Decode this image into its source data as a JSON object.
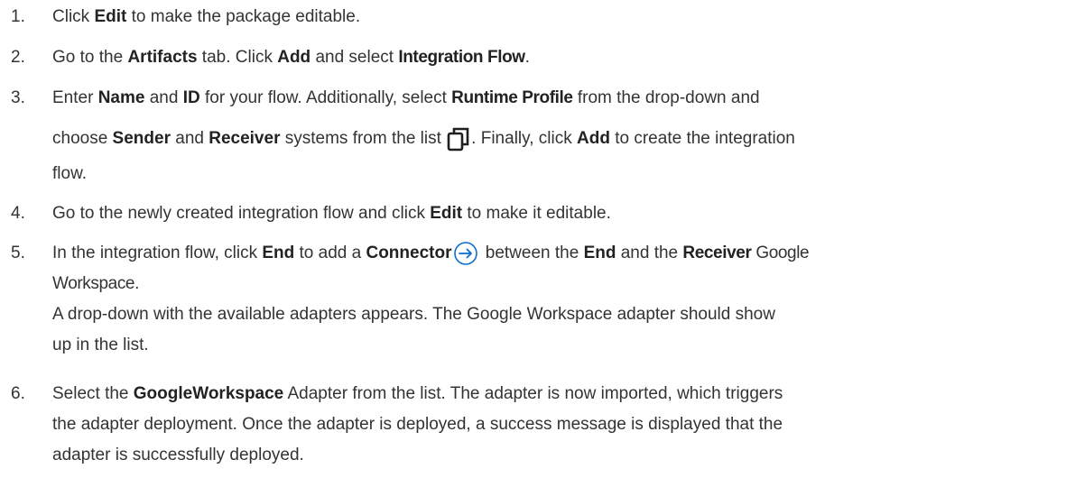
{
  "steps": [
    {
      "number": "1.",
      "p1": "Click ",
      "b1": "Edit",
      "p2": " to make the package editable."
    },
    {
      "number": "2.",
      "p1": "Go to the ",
      "b1": "Artifacts",
      "p2": " tab. Click ",
      "b2": "Add",
      "p3": " and select ",
      "b3": "Integration Flow",
      "p4": "."
    },
    {
      "number": "3.",
      "p1": "Enter ",
      "b1": "Name",
      "p2": " and ",
      "b2": "ID",
      "p3": " for your flow. Additionally, select ",
      "b3": "Runtime Profile",
      "p4": " from the drop-down and",
      "p5": "choose ",
      "b4": "Sender",
      "p6": " and ",
      "b5": "Receiver",
      "p7": " systems from the list ",
      "p8": ". Finally, click ",
      "b6": "Add",
      "p9": " to create the integration",
      "p10": "flow."
    },
    {
      "number": "4.",
      "p1": "Go to the newly created integration flow and click ",
      "b1": "Edit",
      "p2": " to make it editable."
    },
    {
      "number": "5.",
      "p1": "In the integration flow, click ",
      "b1": "End",
      "p2": " to add a ",
      "b2": "Connector",
      "p3": " between the ",
      "b3": "End",
      "p4": " and the ",
      "b4": "Receiver",
      "p5": " Google",
      "p6": "Workspace.",
      "p7": "A drop-down with the available adapters appears. The Google Workspace adapter should show",
      "p8": "up in the list."
    },
    {
      "number": "6.",
      "p1": "Select the ",
      "b1": "GoogleWorkspace",
      "p2": " Adapter from the list. The adapter is now imported, which triggers",
      "p3": "the adapter deployment. Once the adapter is deployed, a success message is displayed that the",
      "p4": "adapter is successfully deployed."
    }
  ],
  "icons": {
    "copy": "copy-icon",
    "connector": "arrow-right-circle-icon"
  },
  "colors": {
    "text": "#333333",
    "icon": "#1f1f1f",
    "connector_icon": "#0a6ed1"
  }
}
